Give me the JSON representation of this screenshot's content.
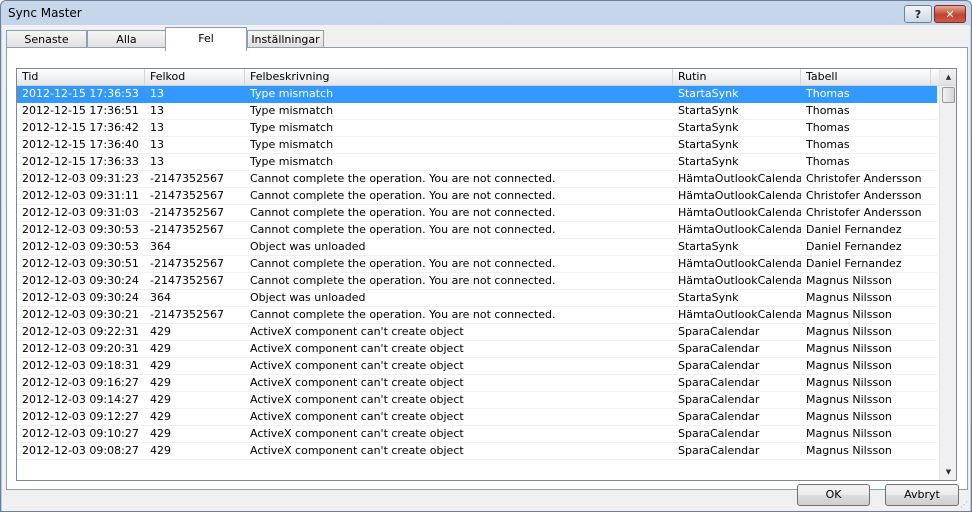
{
  "window": {
    "title": "Sync Master",
    "help_label": "?",
    "close_label": "✕"
  },
  "tabs": [
    {
      "label": "Senaste"
    },
    {
      "label": "Alla"
    },
    {
      "label": "Fel"
    },
    {
      "label": "Inställningar"
    }
  ],
  "active_tab": "Fel",
  "table": {
    "columns": [
      "Tid",
      "Felkod",
      "Felbeskrivning",
      "Rutin",
      "Tabell"
    ],
    "rows": [
      [
        "2012-12-15 17:36:53",
        "13",
        "Type mismatch",
        "StartaSynk",
        "Thomas"
      ],
      [
        "2012-12-15 17:36:51",
        "13",
        "Type mismatch",
        "StartaSynk",
        "Thomas"
      ],
      [
        "2012-12-15 17:36:42",
        "13",
        "Type mismatch",
        "StartaSynk",
        "Thomas"
      ],
      [
        "2012-12-15 17:36:40",
        "13",
        "Type mismatch",
        "StartaSynk",
        "Thomas"
      ],
      [
        "2012-12-15 17:36:33",
        "13",
        "Type mismatch",
        "StartaSynk",
        "Thomas"
      ],
      [
        "2012-12-03 09:31:23",
        "-2147352567",
        "Cannot complete the operation. You are not connected.",
        "HämtaOutlookCalendar",
        "Christofer Andersson"
      ],
      [
        "2012-12-03 09:31:11",
        "-2147352567",
        "Cannot complete the operation. You are not connected.",
        "HämtaOutlookCalendar",
        "Christofer Andersson"
      ],
      [
        "2012-12-03 09:31:03",
        "-2147352567",
        "Cannot complete the operation. You are not connected.",
        "HämtaOutlookCalendar",
        "Christofer Andersson"
      ],
      [
        "2012-12-03 09:30:53",
        "-2147352567",
        "Cannot complete the operation. You are not connected.",
        "HämtaOutlookCalendar",
        "Daniel Fernandez"
      ],
      [
        "2012-12-03 09:30:53",
        "364",
        "Object was unloaded",
        "StartaSynk",
        "Daniel Fernandez"
      ],
      [
        "2012-12-03 09:30:51",
        "-2147352567",
        "Cannot complete the operation. You are not connected.",
        "HämtaOutlookCalendar",
        "Daniel Fernandez"
      ],
      [
        "2012-12-03 09:30:24",
        "-2147352567",
        "Cannot complete the operation. You are not connected.",
        "HämtaOutlookCalendar",
        "Magnus Nilsson"
      ],
      [
        "2012-12-03 09:30:24",
        "364",
        "Object was unloaded",
        "StartaSynk",
        "Magnus Nilsson"
      ],
      [
        "2012-12-03 09:30:21",
        "-2147352567",
        "Cannot complete the operation. You are not connected.",
        "HämtaOutlookCalendar",
        "Magnus Nilsson"
      ],
      [
        "2012-12-03 09:22:31",
        "429",
        "ActiveX component can't create object",
        "SparaCalendar",
        "Magnus Nilsson"
      ],
      [
        "2012-12-03 09:20:31",
        "429",
        "ActiveX component can't create object",
        "SparaCalendar",
        "Magnus Nilsson"
      ],
      [
        "2012-12-03 09:18:31",
        "429",
        "ActiveX component can't create object",
        "SparaCalendar",
        "Magnus Nilsson"
      ],
      [
        "2012-12-03 09:16:27",
        "429",
        "ActiveX component can't create object",
        "SparaCalendar",
        "Magnus Nilsson"
      ],
      [
        "2012-12-03 09:14:27",
        "429",
        "ActiveX component can't create object",
        "SparaCalendar",
        "Magnus Nilsson"
      ],
      [
        "2012-12-03 09:12:27",
        "429",
        "ActiveX component can't create object",
        "SparaCalendar",
        "Magnus Nilsson"
      ],
      [
        "2012-12-03 09:10:27",
        "429",
        "ActiveX component can't create object",
        "SparaCalendar",
        "Magnus Nilsson"
      ],
      [
        "2012-12-03 09:08:27",
        "429",
        "ActiveX component can't create object",
        "SparaCalendar",
        "Magnus Nilsson"
      ]
    ],
    "selected_row": 0
  },
  "scrollbar": {
    "up_icon": "arrow-up-icon",
    "down_icon": "arrow-down-icon"
  },
  "buttons": {
    "ok_label": "OK",
    "cancel_label": "Avbryt"
  },
  "colors": {
    "selection": "#3399ff",
    "titlebar": "#c6d7ec",
    "close_button": "#c1442e"
  }
}
